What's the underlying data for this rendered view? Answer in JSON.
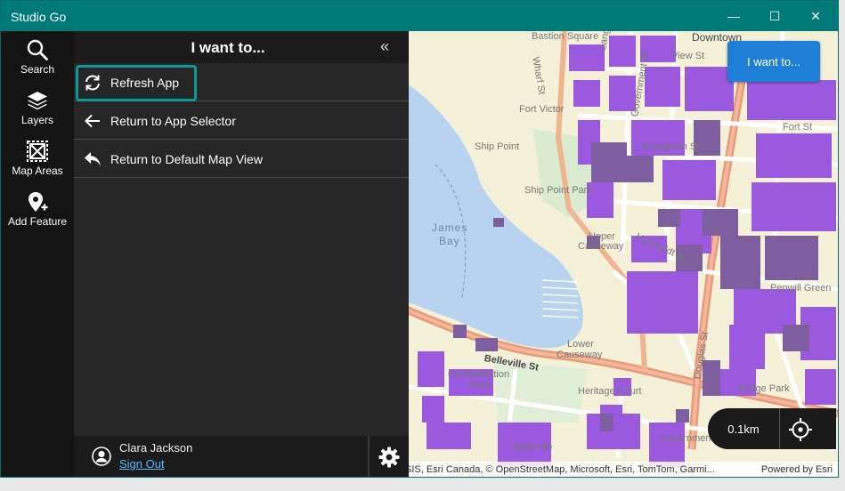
{
  "window": {
    "title": "Studio Go",
    "minimize_glyph": "—",
    "maximize_glyph": "☐",
    "close_glyph": "✕"
  },
  "rail": {
    "items": [
      {
        "label": "Search",
        "icon": "search-icon"
      },
      {
        "label": "Layers",
        "icon": "layers-icon"
      },
      {
        "label": "Map Areas",
        "icon": "map-areas-icon"
      },
      {
        "label": "Add Feature",
        "icon": "add-feature-icon"
      }
    ]
  },
  "panel": {
    "title": "I want to...",
    "collapse_glyph": "«",
    "items": [
      {
        "label": "Refresh App",
        "icon": "refresh-icon",
        "focused": true
      },
      {
        "label": "Return to App Selector",
        "icon": "arrow-left-icon"
      },
      {
        "label": "Return to Default Map View",
        "icon": "reply-icon"
      }
    ]
  },
  "user": {
    "name": "Clara Jackson",
    "sign_out": "Sign Out"
  },
  "map": {
    "iwant_button": "I want to...",
    "scale": "0.1km",
    "attribution": "SIS, Esri Canada, © OpenStreetMap, Microsoft, Esri, TomTom, Garmi...",
    "powered_by": "Powered by Esri",
    "labels": {
      "bastion": "Bastion Square",
      "downtown": "Downtown",
      "wharf": "Wharf St",
      "langley": "Langley St",
      "government": "Government St",
      "view": "View St",
      "fort_victoria": "Fort Victor",
      "fort": "Fort St",
      "ship_point": "Ship Point",
      "broughton": "Broughton St",
      "ship_point_park": "Ship Point Park",
      "james_bay_1": "James",
      "james_bay_2": "Bay",
      "upper_causeway_1": "Upper",
      "upper_causeway_2": "Causeway",
      "humboldt": "Humboldt St",
      "penwill": "Penwill Green",
      "douglas": "Douglas St",
      "lower_causeway_1": "Lower",
      "lower_causeway_2": "Causeway",
      "belleville": "Belleville St",
      "confederation_1": "Confederation",
      "confederation_2": "Plaza",
      "heritage": "Heritage Court",
      "bridge": "Bridge Park",
      "government_2": "Government",
      "belleville_2": "Belleville"
    },
    "colors": {
      "land": "#f4f1d8",
      "water": "#b7d3ef",
      "building": "#9b59e0",
      "building_dark": "#7d5fa0",
      "major_road": "#e89a7a",
      "minor_road": "#ffffff",
      "park": "#d9ecd0"
    }
  }
}
